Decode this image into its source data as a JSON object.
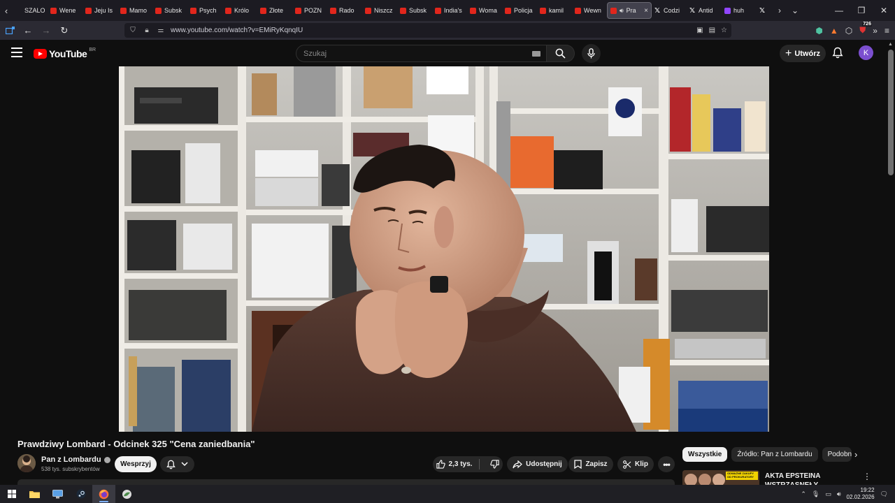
{
  "browser": {
    "tabs": [
      {
        "title": "SZALO",
        "icon": "none"
      },
      {
        "title": "Wene",
        "icon": "youtube"
      },
      {
        "title": "Jeju Is",
        "icon": "youtube"
      },
      {
        "title": "Mamo",
        "icon": "youtube"
      },
      {
        "title": "Subsk",
        "icon": "youtube"
      },
      {
        "title": "Psych",
        "icon": "youtube"
      },
      {
        "title": "Królo",
        "icon": "youtube"
      },
      {
        "title": "Złote",
        "icon": "youtube"
      },
      {
        "title": "POZN",
        "icon": "youtube"
      },
      {
        "title": "Rado",
        "icon": "youtube"
      },
      {
        "title": "Niszcz",
        "icon": "youtube"
      },
      {
        "title": "Subsk",
        "icon": "youtube"
      },
      {
        "title": "India's",
        "icon": "youtube"
      },
      {
        "title": "Woma",
        "icon": "youtube"
      },
      {
        "title": "Policja",
        "icon": "youtube"
      },
      {
        "title": "kamil",
        "icon": "youtube"
      },
      {
        "title": "Wewn",
        "icon": "youtube"
      }
    ],
    "active_tab": {
      "title": "Pra",
      "close": "×"
    },
    "tabs_after": [
      {
        "title": "Codzi",
        "icon": "x"
      },
      {
        "title": "Antid",
        "icon": "x"
      },
      {
        "title": "huh",
        "icon": "twitch"
      },
      {
        "title": "",
        "icon": "x"
      }
    ],
    "url": "www.youtube.com/watch?v=EMiRyKqnqIU",
    "extension_badge": "726"
  },
  "youtube": {
    "logo_text": "YouTube",
    "country_code": "BR",
    "search_placeholder": "Szukaj",
    "create_label": "Utwórz",
    "avatar_letter": "K",
    "accent": "#ff0000",
    "avatar_color": "#7b4fcf"
  },
  "video": {
    "title": "Prawdziwy Lombard - Odcinek 325 \"Cena zaniedbania\"",
    "channel_name": "Pan z Lombardu",
    "subscribers": "538 tys. subskrybentów",
    "support_label": "Wesprzyj",
    "likes": "2,3 tys.",
    "share_label": "Udostępnij",
    "save_label": "Zapisz",
    "clip_label": "Klip"
  },
  "sidebar": {
    "chips": [
      {
        "label": "Wszystkie",
        "active": true
      },
      {
        "label": "Źródło: Pan z Lombardu",
        "active": false
      },
      {
        "label": "Podobne",
        "active": false
      }
    ],
    "recommendation": {
      "title": "AKTA EPSTEINA WSTRZĄSNĘŁY ŚWIATEM",
      "thumb_caption": "ODWAŻNE ZAKUPY OD PROKURATORY"
    }
  },
  "taskbar": {
    "time": "19:22",
    "date": "02.02.2026"
  }
}
